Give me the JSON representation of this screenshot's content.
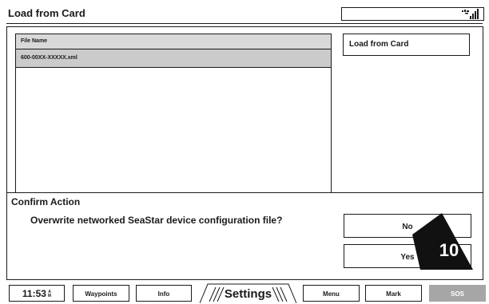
{
  "header": {
    "title": "Load from Card",
    "status_icon": "signal-strength-icon"
  },
  "file_list": {
    "column_header": "File Name",
    "rows": [
      {
        "name": "600-00XX-XXXXX.xml",
        "selected": true
      }
    ]
  },
  "side_panel": {
    "load_label": "Load from Card"
  },
  "confirm": {
    "title": "Confirm Action",
    "message": "Overwrite networked SeaStar device configuration file?",
    "no_label": "No",
    "yes_label": "Yes",
    "callout_number": "10"
  },
  "nav": {
    "time": "11:53",
    "ampm_top": "A",
    "ampm_bottom": "M",
    "waypoints": "Waypoints",
    "info": "Info",
    "settings": "Settings",
    "menu": "Menu",
    "mark": "Mark",
    "sos": "SOS",
    "sos_color": "#a6a6a6"
  }
}
